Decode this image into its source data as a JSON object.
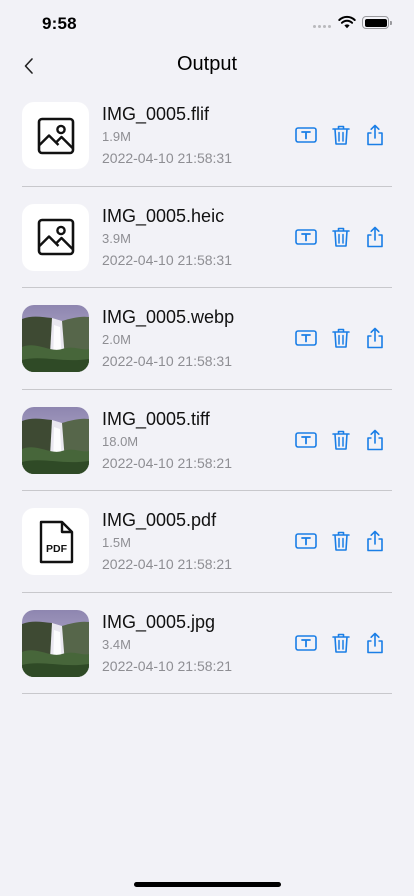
{
  "status_bar": {
    "time": "9:58"
  },
  "nav": {
    "title": "Output",
    "back_icon": "chevron-left-icon"
  },
  "colors": {
    "accent": "#1a7ee6",
    "background": "#f2f2f7",
    "secondary_text": "#8e8e93",
    "separator": "#c8c8cc"
  },
  "files": [
    {
      "name": "IMG_0005.flif",
      "size": "1.9M",
      "date": "2022-04-10 21:58:31",
      "thumbnail": "image-placeholder-icon"
    },
    {
      "name": "IMG_0005.heic",
      "size": "3.9M",
      "date": "2022-04-10 21:58:31",
      "thumbnail": "image-placeholder-icon"
    },
    {
      "name": "IMG_0005.webp",
      "size": "2.0M",
      "date": "2022-04-10 21:58:31",
      "thumbnail": "waterfall-photo"
    },
    {
      "name": "IMG_0005.tiff",
      "size": "18.0M",
      "date": "2022-04-10 21:58:21",
      "thumbnail": "waterfall-photo"
    },
    {
      "name": "IMG_0005.pdf",
      "size": "1.5M",
      "date": "2022-04-10 21:58:21",
      "thumbnail": "pdf-file-icon",
      "thumbnail_label": "PDF"
    },
    {
      "name": "IMG_0005.jpg",
      "size": "3.4M",
      "date": "2022-04-10 21:58:21",
      "thumbnail": "waterfall-photo"
    }
  ],
  "row_actions": [
    "rename-icon",
    "trash-icon",
    "share-icon"
  ]
}
